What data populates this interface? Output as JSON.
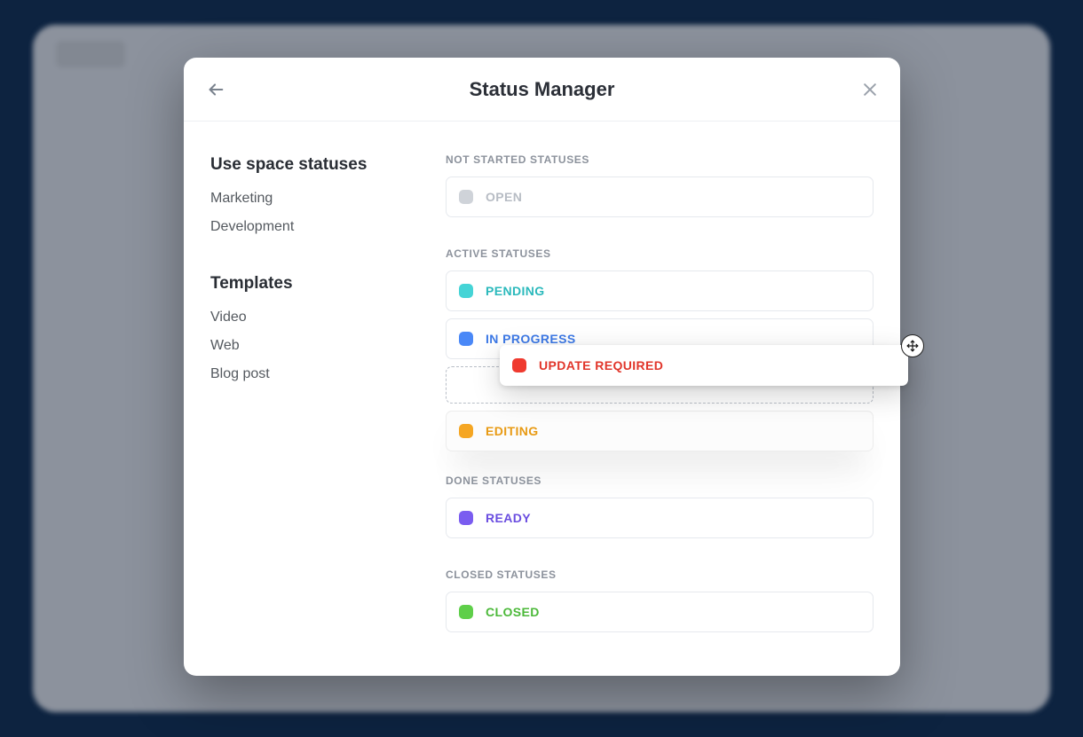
{
  "modal": {
    "title": "Status Manager"
  },
  "sidebar": {
    "section1_title": "Use space statuses",
    "section1_items": [
      "Marketing",
      "Development"
    ],
    "section2_title": "Templates",
    "section2_items": [
      "Video",
      "Web",
      "Blog post"
    ]
  },
  "groups": {
    "not_started": {
      "label": "NOT STARTED STATUSES"
    },
    "active": {
      "label": "ACTIVE STATUSES"
    },
    "done": {
      "label": "DONE STATUSES"
    },
    "closed": {
      "label": "CLOSED STATUSES"
    }
  },
  "statuses": {
    "open": {
      "label": "OPEN",
      "color": "#cfd3d9"
    },
    "pending": {
      "label": "PENDING",
      "color": "#45d4d6"
    },
    "in_progress": {
      "label": "IN PROGRESS",
      "color": "#4a88f7"
    },
    "update_req": {
      "label": "UPDATE REQUIRED",
      "color": "#ef3a2f"
    },
    "editing": {
      "label": "EDITING",
      "color": "#f5a623"
    },
    "ready": {
      "label": "READY",
      "color": "#7a5cf0"
    },
    "closed": {
      "label": "CLOSED",
      "color": "#5fcf4a"
    }
  }
}
